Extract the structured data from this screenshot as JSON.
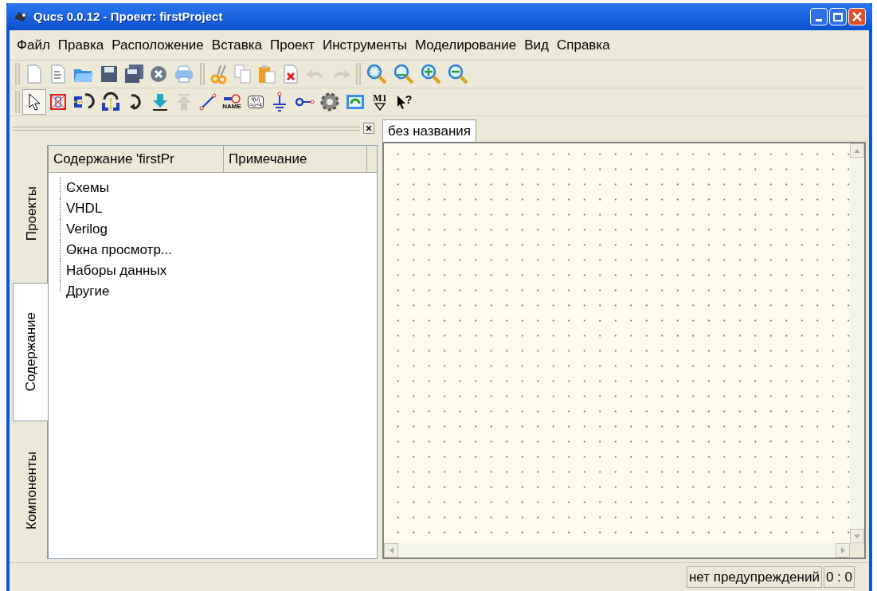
{
  "window": {
    "title": "Qucs 0.0.12 - Проект: firstProject"
  },
  "menu": [
    "Файл",
    "Правка",
    "Расположение",
    "Вставка",
    "Проект",
    "Инструменты",
    "Моделирование",
    "Вид",
    "Справка"
  ],
  "toolbars": [
    {
      "groups": [
        {
          "items": [
            {
              "kind": "new",
              "disabled": false
            },
            {
              "kind": "text",
              "disabled": false
            },
            {
              "kind": "open",
              "disabled": false
            },
            {
              "kind": "save",
              "disabled": false
            },
            {
              "kind": "saveall",
              "disabled": false
            },
            {
              "kind": "close",
              "disabled": false
            },
            {
              "kind": "print",
              "disabled": false
            }
          ]
        },
        {
          "items": [
            {
              "kind": "cut",
              "disabled": false
            },
            {
              "kind": "copy",
              "disabled": false
            },
            {
              "kind": "paste",
              "disabled": false
            },
            {
              "kind": "delete",
              "disabled": false
            },
            {
              "kind": "undo",
              "disabled": true
            },
            {
              "kind": "redo",
              "disabled": true
            }
          ]
        },
        {
          "items": [
            {
              "kind": "zoomfit",
              "disabled": false
            },
            {
              "kind": "zoom1",
              "disabled": false
            },
            {
              "kind": "zoomin",
              "disabled": false
            },
            {
              "kind": "zoomout",
              "disabled": false
            }
          ]
        }
      ]
    },
    {
      "groups": [
        {
          "items": [
            {
              "kind": "pointer",
              "disabled": false,
              "selected": true
            },
            {
              "kind": "component",
              "disabled": false,
              "selected": false
            },
            {
              "kind": "mirrorx",
              "disabled": false,
              "selected": false
            },
            {
              "kind": "mirrory",
              "disabled": false,
              "selected": false
            },
            {
              "kind": "rotate",
              "disabled": false,
              "selected": false
            },
            {
              "kind": "down",
              "disabled": false,
              "selected": false
            },
            {
              "kind": "up",
              "disabled": true,
              "selected": false
            },
            {
              "kind": "wire",
              "disabled": false,
              "selected": false
            },
            {
              "kind": "label",
              "disabled": false,
              "selected": false,
              "label": "NAME"
            },
            {
              "kind": "equation",
              "disabled": false,
              "selected": false,
              "label": "f(u)",
              "label2": "=u+4"
            },
            {
              "kind": "ground",
              "disabled": false,
              "selected": false
            },
            {
              "kind": "port",
              "disabled": false,
              "selected": false
            },
            {
              "kind": "gear",
              "disabled": false,
              "selected": false
            },
            {
              "kind": "simulate",
              "disabled": false,
              "selected": false
            },
            {
              "kind": "marker",
              "disabled": false,
              "selected": false,
              "label": "M1"
            },
            {
              "kind": "help",
              "disabled": false,
              "selected": false,
              "label": "?"
            }
          ]
        }
      ]
    }
  ],
  "side_tabs": [
    {
      "label": "Проекты",
      "selected": false
    },
    {
      "label": "Содержание",
      "selected": true
    },
    {
      "label": "Компоненты",
      "selected": false
    }
  ],
  "content_table": {
    "columns": [
      "Содержание 'firstPr",
      "Примечание"
    ],
    "tree": [
      {
        "label": "Схемы"
      },
      {
        "label": "VHDL"
      },
      {
        "label": "Verilog"
      },
      {
        "label": "Окна просмотр..."
      },
      {
        "label": "Наборы данных"
      },
      {
        "label": "Другие"
      }
    ]
  },
  "document_tabs": [
    {
      "label": "без названия",
      "selected": true
    }
  ],
  "status_bar": {
    "message": "нет предупреждений",
    "position": "0 : 0"
  }
}
